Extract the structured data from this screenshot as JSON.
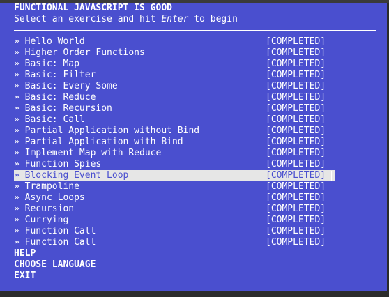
{
  "header": {
    "title": "FUNCTIONAL JAVASCRIPT IS GOOD",
    "instruction_before": "Select an exercise and hit ",
    "instruction_key": "Enter",
    "instruction_after": " to begin"
  },
  "exercises": [
    {
      "label": "» Hello World",
      "status": "[COMPLETED]"
    },
    {
      "label": "» Higher Order Functions",
      "status": "[COMPLETED]"
    },
    {
      "label": "» Basic: Map",
      "status": "[COMPLETED]"
    },
    {
      "label": "» Basic: Filter",
      "status": "[COMPLETED]"
    },
    {
      "label": "» Basic: Every Some",
      "status": "[COMPLETED]"
    },
    {
      "label": "» Basic: Reduce",
      "status": "[COMPLETED]"
    },
    {
      "label": "» Basic: Recursion",
      "status": "[COMPLETED]"
    },
    {
      "label": "» Basic: Call",
      "status": "[COMPLETED]"
    },
    {
      "label": "» Partial Application without Bind",
      "status": "[COMPLETED]"
    },
    {
      "label": "» Partial Application with Bind",
      "status": "[COMPLETED]"
    },
    {
      "label": "» Implement Map with Reduce",
      "status": "[COMPLETED]"
    },
    {
      "label": "» Function Spies",
      "status": "[COMPLETED]"
    },
    {
      "label": "» Blocking Event Loop",
      "status": "[COMPLETED]"
    },
    {
      "label": "» Trampoline",
      "status": "[COMPLETED]"
    },
    {
      "label": "» Async Loops",
      "status": "[COMPLETED]"
    },
    {
      "label": "» Recursion",
      "status": "[COMPLETED]"
    },
    {
      "label": "» Currying",
      "status": "[COMPLETED]"
    },
    {
      "label": "» Function Call",
      "status": "[COMPLETED]"
    },
    {
      "label": "» Function Call",
      "status": "[COMPLETED]"
    }
  ],
  "selected_exercise": "» Blocking Event Loop",
  "options": [
    "HELP",
    "CHOOSE LANGUAGE",
    "EXIT"
  ],
  "colors": {
    "background": "#4a4fcf",
    "text": "#ffffff",
    "highlight": "#e6e6e6"
  }
}
